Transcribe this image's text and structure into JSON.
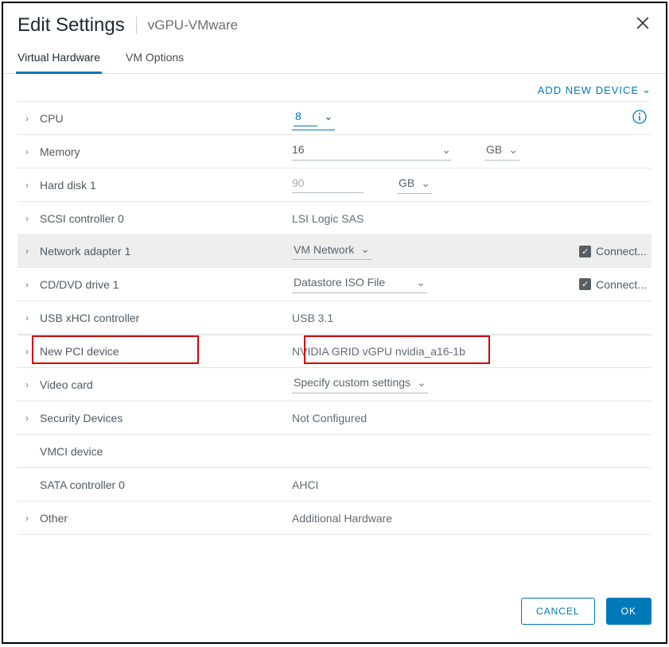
{
  "header": {
    "title": "Edit Settings",
    "subtitle": "vGPU-VMware"
  },
  "tabs": {
    "virtual_hardware": "Virtual Hardware",
    "vm_options": "VM Options"
  },
  "toolbar": {
    "add_new_device": "ADD NEW DEVICE"
  },
  "rows": {
    "cpu": {
      "label": "CPU",
      "value": "8"
    },
    "memory": {
      "label": "Memory",
      "value": "16",
      "unit": "GB"
    },
    "hard_disk": {
      "label": "Hard disk 1",
      "value": "90",
      "unit": "GB"
    },
    "scsi": {
      "label": "SCSI controller 0",
      "value": "LSI Logic SAS"
    },
    "network": {
      "label": "Network adapter 1",
      "value": "VM Network",
      "connect": "Connect..."
    },
    "cddvd": {
      "label": "CD/DVD drive 1",
      "value": "Datastore ISO File",
      "connect": "Connect..."
    },
    "usb": {
      "label": "USB xHCI controller",
      "value": "USB 3.1"
    },
    "pci": {
      "label": "New PCI device",
      "value": "NVIDIA GRID vGPU nvidia_a16-1b"
    },
    "video": {
      "label": "Video card",
      "value": "Specify custom settings"
    },
    "security": {
      "label": "Security Devices",
      "value": "Not Configured"
    },
    "vmci": {
      "label": "VMCI device"
    },
    "sata": {
      "label": "SATA controller 0",
      "value": "AHCI"
    },
    "other": {
      "label": "Other",
      "value": "Additional Hardware"
    }
  },
  "footer": {
    "cancel": "CANCEL",
    "ok": "OK"
  }
}
